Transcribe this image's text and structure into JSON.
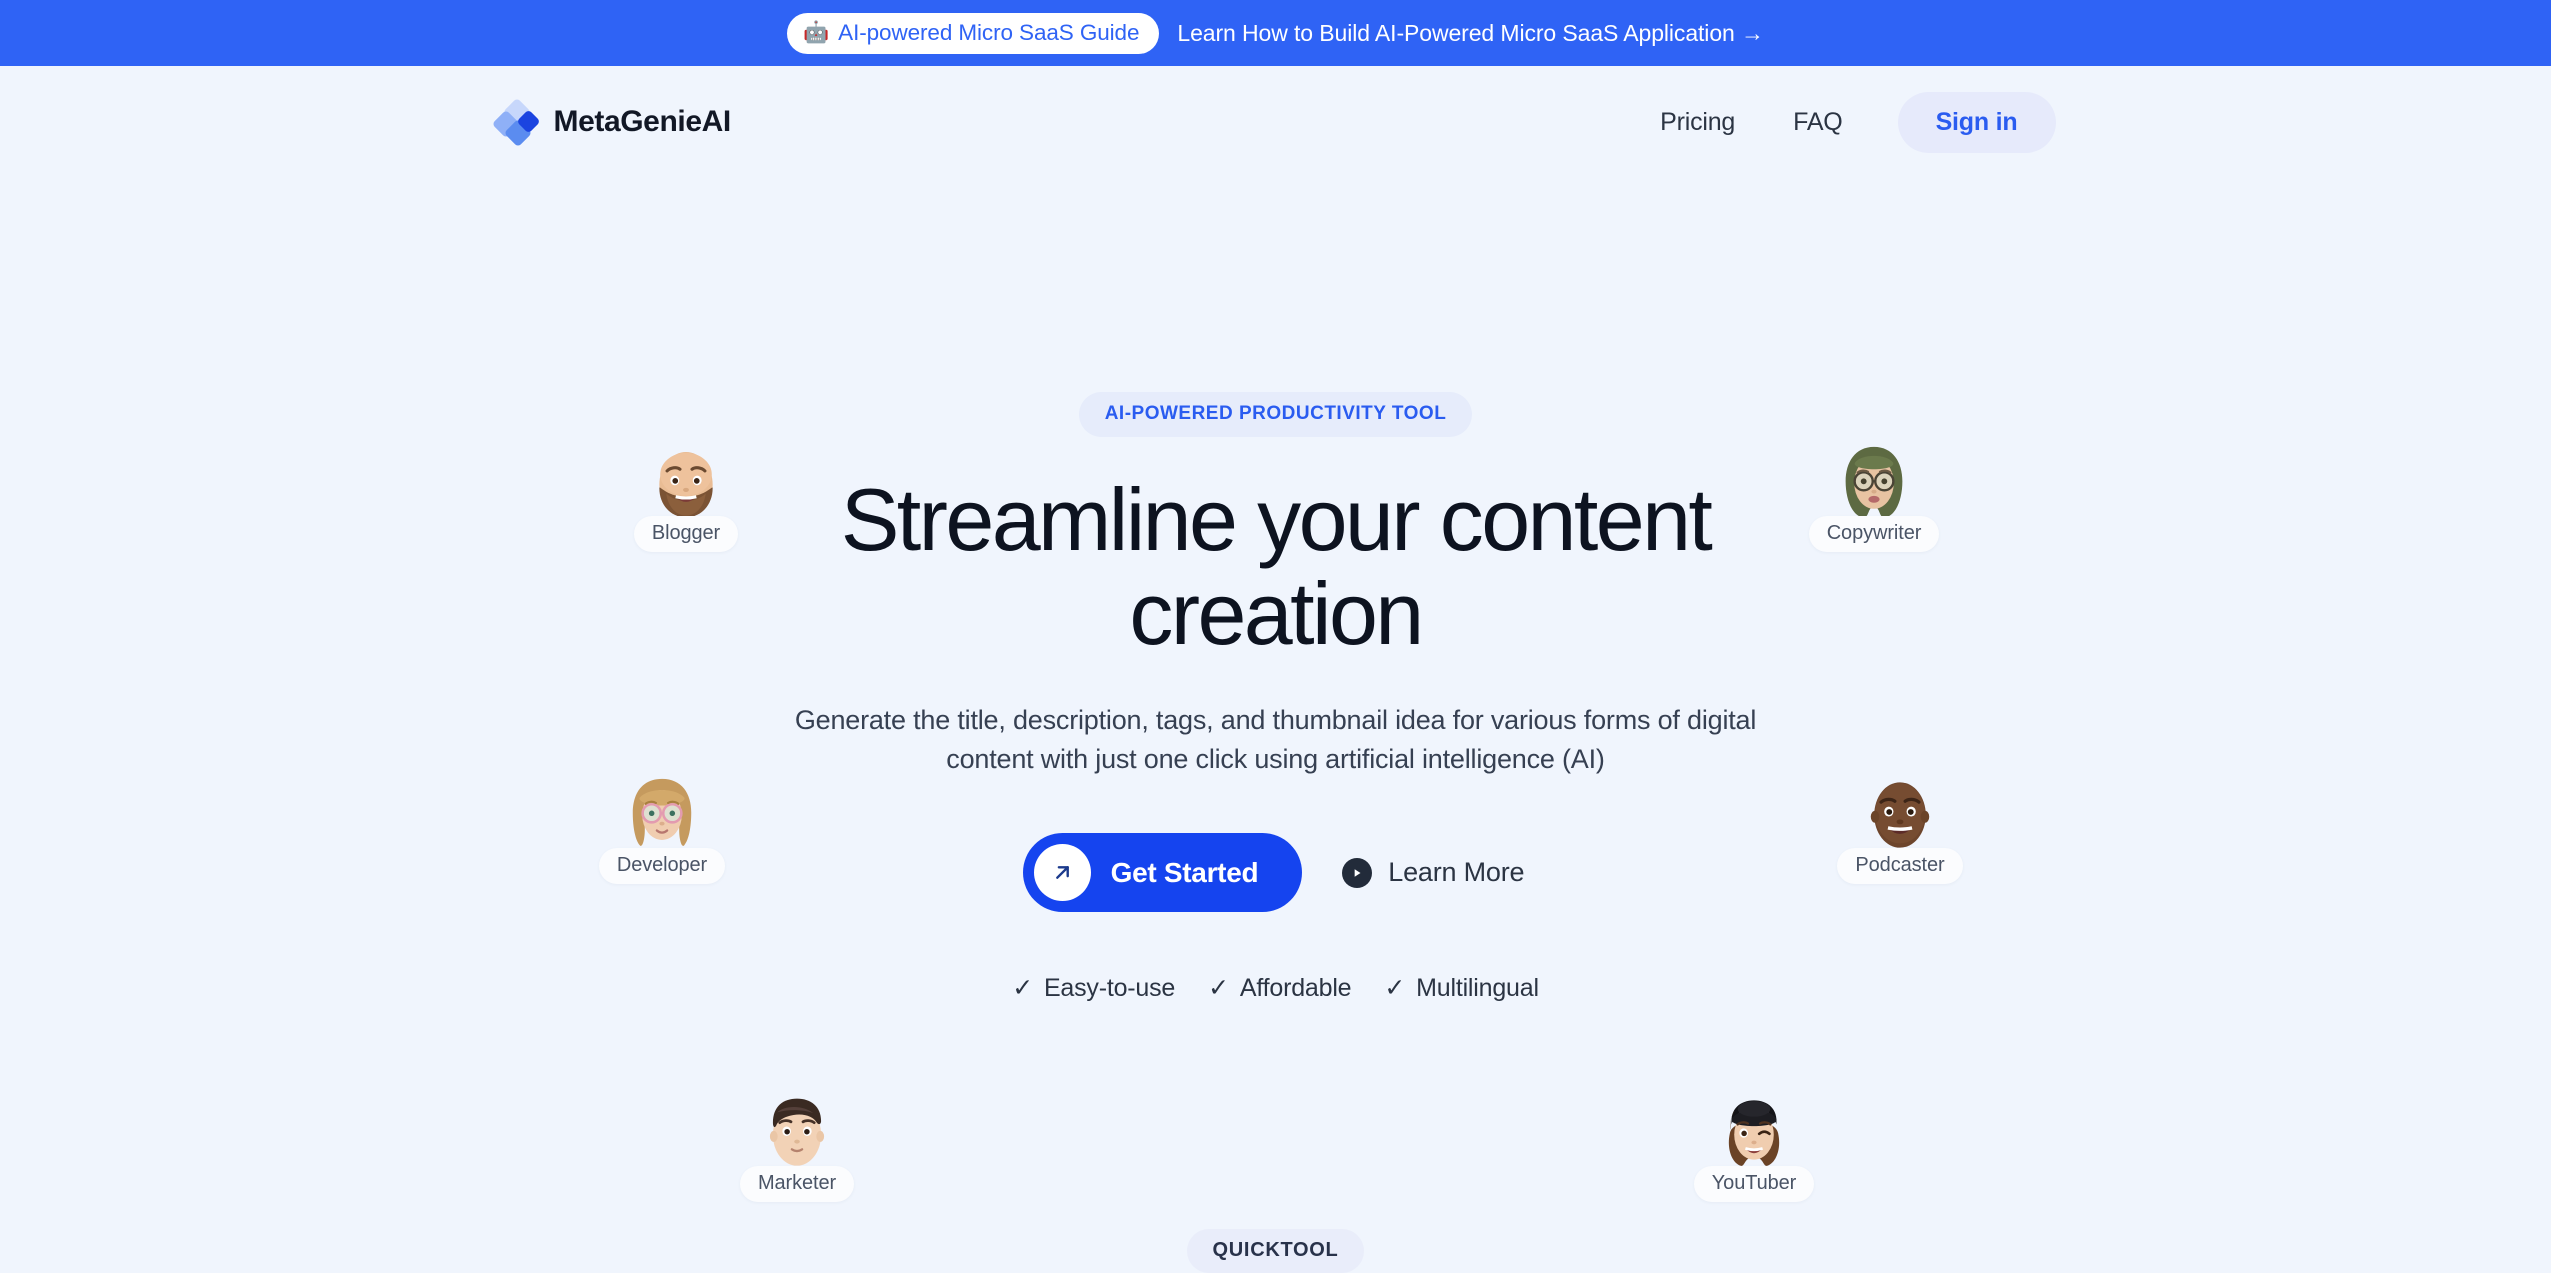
{
  "promo_banner": {
    "pill_icon": "robot-icon",
    "pill_glyph": "🤖",
    "pill_label": "AI-powered Micro SaaS Guide",
    "message": "Learn How to Build AI-Powered Micro SaaS Application →",
    "background_color": "#2f63f5"
  },
  "header": {
    "brand_name": "MetaGenieAI",
    "brand_mark": "diamond-logo-icon",
    "nav": [
      {
        "label": "Pricing",
        "name": "nav-link-pricing"
      },
      {
        "label": "FAQ",
        "name": "nav-link-faq"
      }
    ],
    "signin_label": "Sign in"
  },
  "hero": {
    "badge": "AI-POWERED PRODUCTIVITY TOOL",
    "title": "Streamline your content creation",
    "subtitle": "Generate the title, description, tags, and thumbnail idea for various forms of digital content with just one click using artificial intelligence (AI)",
    "primary_cta": {
      "label": "Get Started",
      "icon": "arrow-up-right-icon"
    },
    "secondary_cta": {
      "label": "Learn More",
      "icon": "play-circle-icon"
    },
    "features": [
      {
        "label": "Easy-to-use",
        "check": "✓"
      },
      {
        "label": "Affordable",
        "check": "✓"
      },
      {
        "label": "Multilingual",
        "check": "✓"
      }
    ]
  },
  "avatars": [
    {
      "label": "Blogger",
      "name": "avatar-chip-blogger"
    },
    {
      "label": "Copywriter",
      "name": "avatar-chip-copywriter"
    },
    {
      "label": "Developer",
      "name": "avatar-chip-developer"
    },
    {
      "label": "Podcaster",
      "name": "avatar-chip-podcaster"
    },
    {
      "label": "Marketer",
      "name": "avatar-chip-marketer"
    },
    {
      "label": "YouTuber",
      "name": "avatar-chip-youtuber"
    }
  ],
  "footer_section": {
    "badge": "QUICKTOOL"
  },
  "colors": {
    "page_background": "#f0f5fd",
    "banner_blue": "#2f63f5",
    "primary_blue": "#1544ef",
    "accent_blue": "#2a5cf0",
    "badge_background": "#e6ecfb",
    "heading": "#0d1320",
    "body_text": "#364052"
  }
}
